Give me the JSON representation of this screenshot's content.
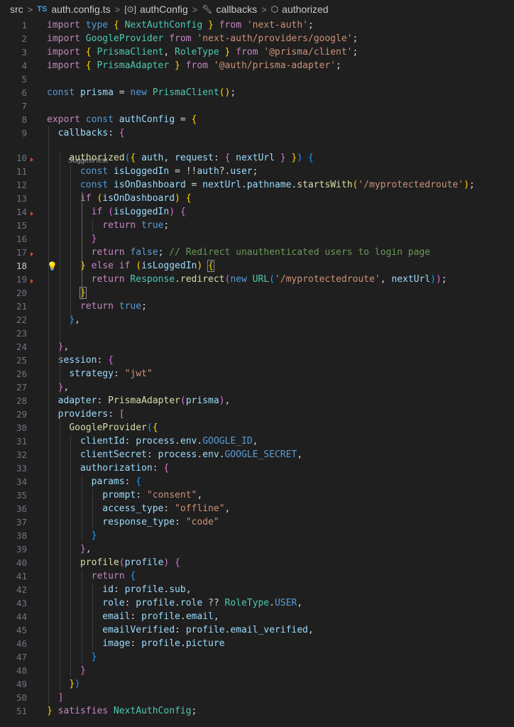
{
  "breadcrumb": {
    "items": [
      "src",
      "TS",
      "auth.config.ts",
      "authConfig",
      "callbacks",
      "authorized"
    ],
    "icons": [
      "chevron-right-icon",
      "typescript-icon",
      "variable-icon",
      "wrench-icon",
      "cube-icon"
    ]
  },
  "editor": {
    "codelens": "Suggest test",
    "active_line": 18,
    "lines": [
      [
        [
          "kc",
          "import "
        ],
        [
          "kw",
          "type "
        ],
        [
          "b1",
          "{ "
        ],
        [
          "ty",
          "NextAuthConfig"
        ],
        [
          "b1",
          " }"
        ],
        [
          "kc",
          " from "
        ],
        [
          "st",
          "'next-auth'"
        ],
        [
          "pl",
          ";"
        ]
      ],
      [
        [
          "kc",
          "import "
        ],
        [
          "ty",
          "GoogleProvider"
        ],
        [
          "kc",
          " from "
        ],
        [
          "st",
          "'next-auth/providers/google'"
        ],
        [
          "pl",
          ";"
        ]
      ],
      [
        [
          "kc",
          "import "
        ],
        [
          "b1",
          "{ "
        ],
        [
          "ty",
          "PrismaClient"
        ],
        [
          "pl",
          ", "
        ],
        [
          "ty",
          "RoleType"
        ],
        [
          "b1",
          " }"
        ],
        [
          "kc",
          " from "
        ],
        [
          "st",
          "'@prisma/client'"
        ],
        [
          "pl",
          ";"
        ]
      ],
      [
        [
          "kc",
          "import "
        ],
        [
          "b1",
          "{ "
        ],
        [
          "ty",
          "PrismaAdapter"
        ],
        [
          "b1",
          " }"
        ],
        [
          "kc",
          " from "
        ],
        [
          "st",
          "'@auth/prisma-adapter'"
        ],
        [
          "pl",
          ";"
        ]
      ],
      [],
      [
        [
          "kw",
          "const "
        ],
        [
          "vr",
          "prisma"
        ],
        [
          "pl",
          " = "
        ],
        [
          "kw",
          "new "
        ],
        [
          "ty",
          "PrismaClient"
        ],
        [
          "b1",
          "()"
        ],
        [
          "pl",
          ";"
        ]
      ],
      [],
      [
        [
          "kc",
          "export "
        ],
        [
          "kw",
          "const "
        ],
        [
          "vr",
          "authConfig"
        ],
        [
          "pl",
          " = "
        ],
        [
          "b1",
          "{"
        ]
      ],
      [
        [
          "pl",
          "  "
        ],
        [
          "vr",
          "callbacks"
        ],
        [
          "pl",
          ": "
        ],
        [
          "b2",
          "{"
        ]
      ],
      [
        [
          "pl",
          "    "
        ],
        [
          "fn",
          "authorized"
        ],
        [
          "b3",
          "("
        ],
        [
          "b1",
          "{ "
        ],
        [
          "vr",
          "auth"
        ],
        [
          "pl",
          ", "
        ],
        [
          "vr",
          "request"
        ],
        [
          "pl",
          ": "
        ],
        [
          "b2",
          "{ "
        ],
        [
          "vr",
          "nextUrl"
        ],
        [
          "b2",
          " }"
        ],
        [
          "b1",
          " }"
        ],
        [
          "b3",
          ")"
        ],
        [
          "pl",
          " "
        ],
        [
          "b3",
          "{"
        ]
      ],
      [
        [
          "pl",
          "      "
        ],
        [
          "kw",
          "const "
        ],
        [
          "vr",
          "isLoggedIn"
        ],
        [
          "pl",
          " = !!"
        ],
        [
          "vr",
          "auth"
        ],
        [
          "pl",
          "?."
        ],
        [
          "vr",
          "user"
        ],
        [
          "pl",
          ";"
        ]
      ],
      [
        [
          "pl",
          "      "
        ],
        [
          "kw",
          "const "
        ],
        [
          "vr",
          "isOnDashboard"
        ],
        [
          "pl",
          " = "
        ],
        [
          "vr",
          "nextUrl"
        ],
        [
          "pl",
          "."
        ],
        [
          "vr",
          "pathname"
        ],
        [
          "pl",
          "."
        ],
        [
          "fn",
          "startsWith"
        ],
        [
          "b1",
          "("
        ],
        [
          "st",
          "'/myprotectedroute'"
        ],
        [
          "b1",
          ")"
        ],
        [
          "pl",
          ";"
        ]
      ],
      [
        [
          "pl",
          "      "
        ],
        [
          "kc",
          "if "
        ],
        [
          "b1",
          "("
        ],
        [
          "vr",
          "isOnDashboard"
        ],
        [
          "b1",
          ")"
        ],
        [
          "pl",
          " "
        ],
        [
          "b1",
          "{"
        ]
      ],
      [
        [
          "pl",
          "        "
        ],
        [
          "kc",
          "if "
        ],
        [
          "b2",
          "("
        ],
        [
          "vr",
          "isLoggedIn"
        ],
        [
          "b2",
          ")"
        ],
        [
          "pl",
          " "
        ],
        [
          "b2",
          "{"
        ]
      ],
      [
        [
          "pl",
          "          "
        ],
        [
          "kc",
          "return "
        ],
        [
          "kw",
          "true"
        ],
        [
          "pl",
          ";"
        ]
      ],
      [
        [
          "pl",
          "        "
        ],
        [
          "b2",
          "}"
        ]
      ],
      [
        [
          "pl",
          "        "
        ],
        [
          "kc",
          "return "
        ],
        [
          "kw",
          "false"
        ],
        [
          "pl",
          "; "
        ],
        [
          "cm",
          "// Redirect unauthenticated users to login page"
        ]
      ],
      [
        [
          "pl",
          "      "
        ],
        [
          "b1",
          "}"
        ],
        [
          "kc",
          " else if "
        ],
        [
          "b1",
          "("
        ],
        [
          "vr",
          "isLoggedIn"
        ],
        [
          "b1",
          ")"
        ],
        [
          "pl",
          " "
        ],
        [
          "b1",
          "{"
        ]
      ],
      [
        [
          "pl",
          "        "
        ],
        [
          "kc",
          "return "
        ],
        [
          "ty",
          "Response"
        ],
        [
          "pl",
          "."
        ],
        [
          "fn",
          "redirect"
        ],
        [
          "b2",
          "("
        ],
        [
          "kw",
          "new "
        ],
        [
          "ty",
          "URL"
        ],
        [
          "b3",
          "("
        ],
        [
          "st",
          "'/myprotectedroute'"
        ],
        [
          "pl",
          ", "
        ],
        [
          "vr",
          "nextUrl"
        ],
        [
          "b3",
          ")"
        ],
        [
          "b2",
          ")"
        ],
        [
          "pl",
          ";"
        ]
      ],
      [
        [
          "pl",
          "      "
        ],
        [
          "b1",
          "}"
        ]
      ],
      [
        [
          "pl",
          "      "
        ],
        [
          "kc",
          "return "
        ],
        [
          "kw",
          "true"
        ],
        [
          "pl",
          ";"
        ]
      ],
      [
        [
          "pl",
          "    "
        ],
        [
          "b3",
          "}"
        ],
        [
          "pl",
          ","
        ]
      ],
      [],
      [
        [
          "pl",
          "  "
        ],
        [
          "b2",
          "}"
        ],
        [
          "pl",
          ","
        ]
      ],
      [
        [
          "pl",
          "  "
        ],
        [
          "vr",
          "session"
        ],
        [
          "pl",
          ": "
        ],
        [
          "b2",
          "{"
        ]
      ],
      [
        [
          "pl",
          "    "
        ],
        [
          "vr",
          "strategy"
        ],
        [
          "pl",
          ": "
        ],
        [
          "st",
          "\"jwt\""
        ]
      ],
      [
        [
          "pl",
          "  "
        ],
        [
          "b2",
          "}"
        ],
        [
          "pl",
          ","
        ]
      ],
      [
        [
          "pl",
          "  "
        ],
        [
          "vr",
          "adapter"
        ],
        [
          "pl",
          ": "
        ],
        [
          "fn",
          "PrismaAdapter"
        ],
        [
          "b2",
          "("
        ],
        [
          "vr",
          "prisma"
        ],
        [
          "b2",
          ")"
        ],
        [
          "pl",
          ","
        ]
      ],
      [
        [
          "pl",
          "  "
        ],
        [
          "vr",
          "providers"
        ],
        [
          "pl",
          ": "
        ],
        [
          "b2",
          "["
        ]
      ],
      [
        [
          "pl",
          "    "
        ],
        [
          "fn",
          "GoogleProvider"
        ],
        [
          "b3",
          "("
        ],
        [
          "b1",
          "{"
        ]
      ],
      [
        [
          "pl",
          "      "
        ],
        [
          "vr",
          "clientId"
        ],
        [
          "pl",
          ": "
        ],
        [
          "vr",
          "process"
        ],
        [
          "pl",
          "."
        ],
        [
          "vr",
          "env"
        ],
        [
          "pl",
          "."
        ],
        [
          "kw",
          "GOOGLE_ID"
        ],
        [
          "pl",
          ","
        ]
      ],
      [
        [
          "pl",
          "      "
        ],
        [
          "vr",
          "clientSecret"
        ],
        [
          "pl",
          ": "
        ],
        [
          "vr",
          "process"
        ],
        [
          "pl",
          "."
        ],
        [
          "vr",
          "env"
        ],
        [
          "pl",
          "."
        ],
        [
          "kw",
          "GOOGLE_SECRET"
        ],
        [
          "pl",
          ","
        ]
      ],
      [
        [
          "pl",
          "      "
        ],
        [
          "vr",
          "authorization"
        ],
        [
          "pl",
          ": "
        ],
        [
          "b2",
          "{"
        ]
      ],
      [
        [
          "pl",
          "        "
        ],
        [
          "vr",
          "params"
        ],
        [
          "pl",
          ": "
        ],
        [
          "b3",
          "{"
        ]
      ],
      [
        [
          "pl",
          "          "
        ],
        [
          "vr",
          "prompt"
        ],
        [
          "pl",
          ": "
        ],
        [
          "st",
          "\"consent\""
        ],
        [
          "pl",
          ","
        ]
      ],
      [
        [
          "pl",
          "          "
        ],
        [
          "vr",
          "access_type"
        ],
        [
          "pl",
          ": "
        ],
        [
          "st",
          "\"offline\""
        ],
        [
          "pl",
          ","
        ]
      ],
      [
        [
          "pl",
          "          "
        ],
        [
          "vr",
          "response_type"
        ],
        [
          "pl",
          ": "
        ],
        [
          "st",
          "\"code\""
        ]
      ],
      [
        [
          "pl",
          "        "
        ],
        [
          "b3",
          "}"
        ]
      ],
      [
        [
          "pl",
          "      "
        ],
        [
          "b2",
          "}"
        ],
        [
          "pl",
          ","
        ]
      ],
      [
        [
          "pl",
          "      "
        ],
        [
          "fn",
          "profile"
        ],
        [
          "b2",
          "("
        ],
        [
          "vr",
          "profile"
        ],
        [
          "b2",
          ")"
        ],
        [
          "pl",
          " "
        ],
        [
          "b2",
          "{"
        ]
      ],
      [
        [
          "pl",
          "        "
        ],
        [
          "kc",
          "return "
        ],
        [
          "b3",
          "{"
        ]
      ],
      [
        [
          "pl",
          "          "
        ],
        [
          "vr",
          "id"
        ],
        [
          "pl",
          ": "
        ],
        [
          "vr",
          "profile"
        ],
        [
          "pl",
          "."
        ],
        [
          "vr",
          "sub"
        ],
        [
          "pl",
          ","
        ]
      ],
      [
        [
          "pl",
          "          "
        ],
        [
          "vr",
          "role"
        ],
        [
          "pl",
          ": "
        ],
        [
          "vr",
          "profile"
        ],
        [
          "pl",
          "."
        ],
        [
          "vr",
          "role"
        ],
        [
          "pl",
          " ?? "
        ],
        [
          "ty",
          "RoleType"
        ],
        [
          "pl",
          "."
        ],
        [
          "kw",
          "USER"
        ],
        [
          "pl",
          ","
        ]
      ],
      [
        [
          "pl",
          "          "
        ],
        [
          "vr",
          "email"
        ],
        [
          "pl",
          ": "
        ],
        [
          "vr",
          "profile"
        ],
        [
          "pl",
          "."
        ],
        [
          "vr",
          "email"
        ],
        [
          "pl",
          ","
        ]
      ],
      [
        [
          "pl",
          "          "
        ],
        [
          "vr",
          "emailVerified"
        ],
        [
          "pl",
          ": "
        ],
        [
          "vr",
          "profile"
        ],
        [
          "pl",
          "."
        ],
        [
          "vr",
          "email_verified"
        ],
        [
          "pl",
          ","
        ]
      ],
      [
        [
          "pl",
          "          "
        ],
        [
          "vr",
          "image"
        ],
        [
          "pl",
          ": "
        ],
        [
          "vr",
          "profile"
        ],
        [
          "pl",
          "."
        ],
        [
          "vr",
          "picture"
        ]
      ],
      [
        [
          "pl",
          "        "
        ],
        [
          "b3",
          "}"
        ]
      ],
      [
        [
          "pl",
          "      "
        ],
        [
          "b2",
          "}"
        ]
      ],
      [
        [
          "pl",
          "    "
        ],
        [
          "b1",
          "}"
        ],
        [
          "b3",
          ")"
        ]
      ],
      [
        [
          "pl",
          "  "
        ],
        [
          "b2",
          "]"
        ]
      ],
      [
        [
          "b1",
          "}"
        ],
        [
          "kc",
          " satisfies "
        ],
        [
          "ty",
          "NextAuthConfig"
        ],
        [
          "pl",
          ";"
        ]
      ]
    ]
  }
}
